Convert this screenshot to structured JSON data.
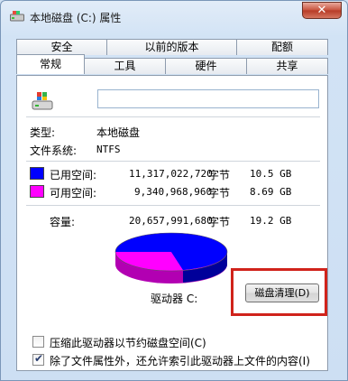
{
  "window": {
    "title": "本地磁盘 (C:) 属性",
    "close_glyph": "✕"
  },
  "tabs_row1": [
    "安全",
    "以前的版本",
    "配额"
  ],
  "tabs_row2": [
    "常规",
    "工具",
    "硬件",
    "共享"
  ],
  "active_tab": "常规",
  "general": {
    "name_value": "",
    "type_label": "类型:",
    "type_value": "本地磁盘",
    "fs_label": "文件系统:",
    "fs_value": "NTFS",
    "used": {
      "label": "已用空间:",
      "bytes": "11,317,022,720",
      "unit": "字节",
      "size": "10.5 GB",
      "color": "#0000ff"
    },
    "free": {
      "label": "可用空间:",
      "bytes": "9,340,968,960",
      "unit": "字节",
      "size": "8.69 GB",
      "color": "#ff00ff"
    },
    "capacity": {
      "label": "容量:",
      "bytes": "20,657,991,680",
      "unit": "字节",
      "size": "19.2 GB"
    },
    "drive_label": "驱动器 C:",
    "cleanup_button": "磁盘清理(D)",
    "compress_label": "压缩此驱动器以节约磁盘空间(C)",
    "compress_checked": false,
    "index_label": "除了文件属性外，还允许索引此驱动器上文件的内容(I)",
    "index_checked": true
  },
  "icons": {
    "title": "drive-icon",
    "drive": "windows-drive-icon",
    "check": "checkmark-icon"
  }
}
